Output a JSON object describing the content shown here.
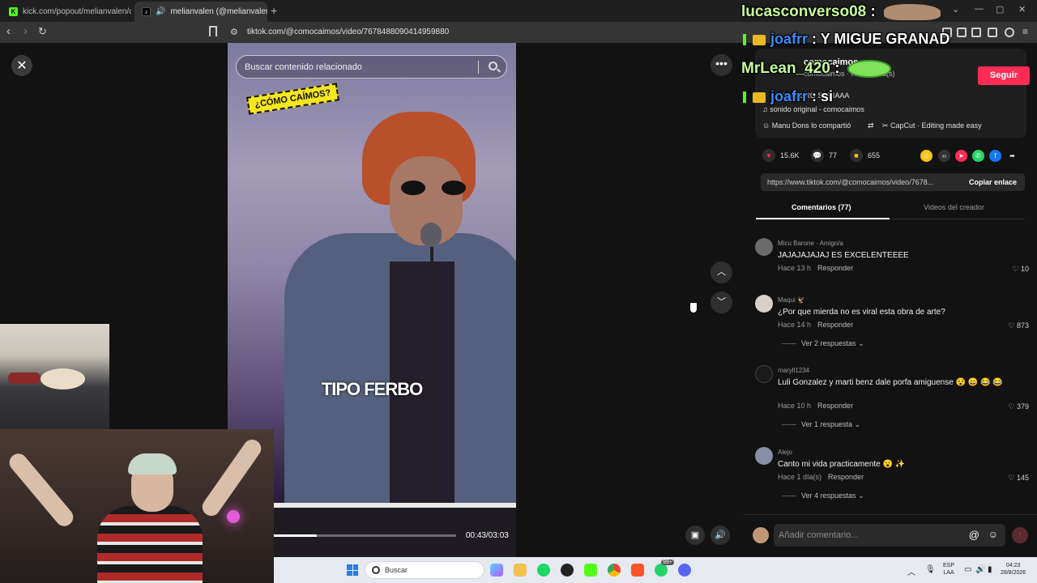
{
  "browser": {
    "tabs": [
      {
        "title": "kick.com/popout/melianvalen/chat",
        "favicon": "kick-icon"
      },
      {
        "title": "melianvalen (@melianvalen)",
        "favicon": "tiktok-icon",
        "close": "✕"
      }
    ],
    "new_tab": "+",
    "window_controls": [
      "⌄",
      "—",
      "▢",
      "✕"
    ],
    "url": "tiktok.com/@comocaimos/video/7678488090414959880"
  },
  "video": {
    "search_placeholder": "Buscar contenido relacionado",
    "sticker_text": "¿CÓMO CAÍMOS?",
    "caption": "TIPO FERBO",
    "time": "00:43/03:03",
    "progress_fraction": 0.235
  },
  "author": {
    "name": "comocaimos",
    "sub": "comocaimos · Hace 1 día(s)",
    "follow_label": "Seguir",
    "desc_line": "Y QUE ERO SERIAAA",
    "sound": "sonido original - comocaimos",
    "shared_by": "Manu Dons lo compartió",
    "capcut": "CapCut · Editing made easy"
  },
  "stats": {
    "likes": "15.6K",
    "comments": "77",
    "saves": "655"
  },
  "link": {
    "url": "https://www.tiktok.com/@comocaimos/video/7678...",
    "copy_label": "Copiar enlace"
  },
  "tabs": {
    "comments": "Comentarios (77)",
    "creator_videos": "Videos del creador"
  },
  "comments": [
    {
      "user": "Micu Barone · Amigo/a",
      "text": "JAJAJAJAJAJ ES EXCELENTEEEE",
      "meta": "Hace 13 h",
      "reply": "Responder",
      "likes": "10",
      "more": ""
    },
    {
      "user": "Maqui 🦅",
      "text": "¿Por que mierda no es viral esta obra de arte?",
      "meta": "Hace 14 h",
      "reply": "Responder",
      "likes": "873",
      "more": "Ver 2 respuestas"
    },
    {
      "user": "maryll1234",
      "text": "Luli Gonzalez y marti benz dale porfa amiguense 😵 😄 😂 😂",
      "meta": "Hace 10 h",
      "reply": "Responder",
      "likes": "379",
      "more": "Ver 1 respuesta"
    },
    {
      "user": "Alejo",
      "text": "Canto mi vida practicamente 😮 ✨",
      "meta": "Hace 1 día(s)",
      "reply": "Responder",
      "likes": "145",
      "more": "Ver 4 respuestas"
    }
  ],
  "composer": {
    "placeholder": "Añadir comentario...",
    "at": "@",
    "emoji": "☺",
    "send": "↑"
  },
  "chat_overlay": [
    {
      "user": "lucasconverso08",
      "sep": " :",
      "message": ""
    },
    {
      "user": "joafrr",
      "sep": " : ",
      "message": "Y MIGUE GRANAD"
    },
    {
      "user": "MrLean_420",
      "sep": " :",
      "message": ""
    },
    {
      "user": "joafrr",
      "sep": " : ",
      "message": "si"
    }
  ],
  "taskbar": {
    "search_label": "Buscar",
    "lang": "ESP",
    "lang2": "LAA",
    "time": "04:23",
    "date": "28/8/2026",
    "badge": "99+"
  },
  "colors": {
    "accent": "#fe2c55",
    "kick_green": "#53fc18",
    "chat_blue": "#3a8dff"
  }
}
